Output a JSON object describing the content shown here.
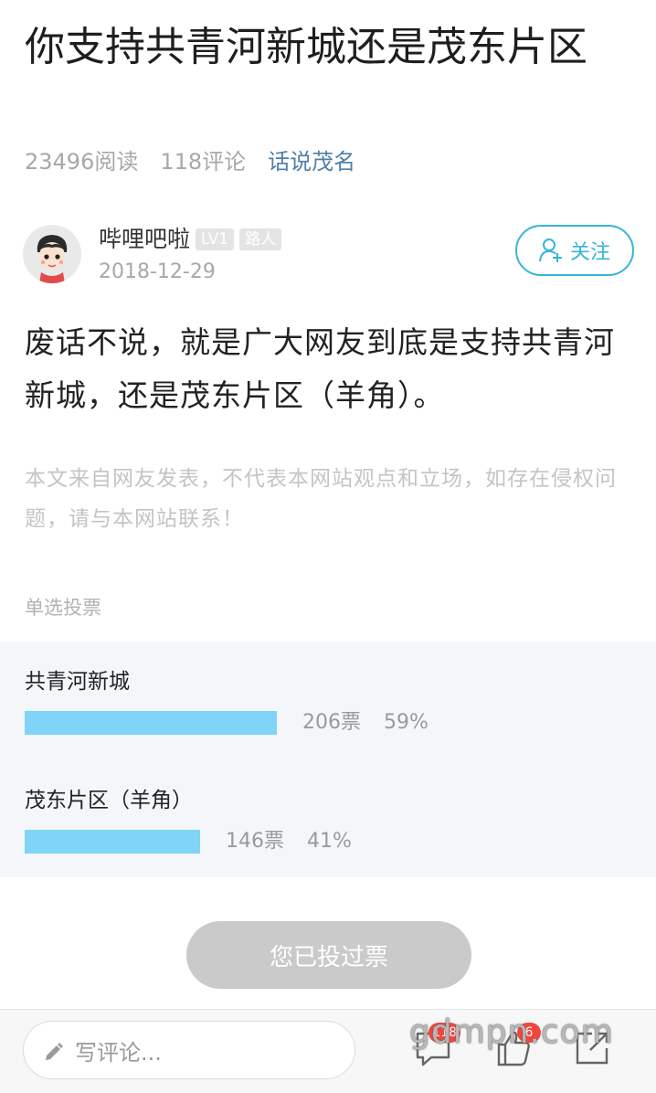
{
  "article": {
    "title": "你支持共青河新城还是茂东片区",
    "reads": "23496阅读",
    "comments": "118评论",
    "forum": "话说茂名",
    "body": "废话不说，就是广大网友到底是支持共青河新城，还是茂东片区（羊角）。",
    "disclaimer": "本文来自网友发表，不代表本网站观点和立场，如存在侵权问题，请与本网站联系！"
  },
  "author": {
    "name": "哔哩吧啦",
    "level": "LV1",
    "rank": "路人",
    "date": "2018-12-29",
    "follow_label": "关注"
  },
  "poll": {
    "type_label": "单选投票",
    "options": [
      {
        "label": "共青河新城",
        "votes": "206票",
        "percent": "59%",
        "fraction": 0.59
      },
      {
        "label": "茂东片区（羊角）",
        "votes": "146票",
        "percent": "41%",
        "fraction": 0.41
      }
    ],
    "voted_label": "您已投过票"
  },
  "bottom_bar": {
    "comment_placeholder": "写评论...",
    "comment_count_badge": "118",
    "like_count_badge": "6"
  },
  "watermark": "gdmpn.com",
  "colors": {
    "accent": "#35b6d8",
    "bar": "#7fd4f8",
    "forum_link": "#4e7fa8",
    "badge_red": "#f0473e"
  }
}
